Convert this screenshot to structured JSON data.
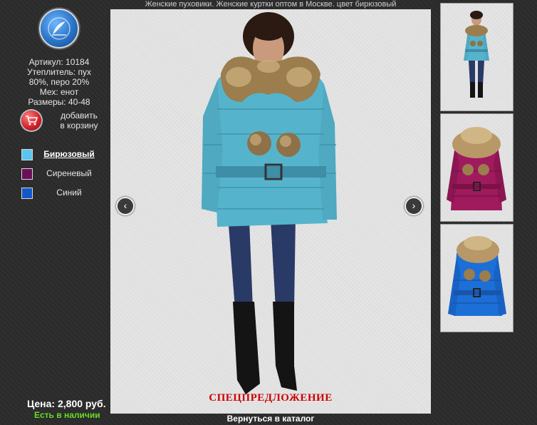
{
  "page_title": "Женские пуховики. Женские куртки оптом в Москве. цвет бирюзовый",
  "product": {
    "article": "Артикул: 10184",
    "insulation_line1": "Утеплитель: пух",
    "insulation_line2": "80%, перо 20%",
    "fur": "Мех: енот",
    "sizes": "Размеры: 40-48"
  },
  "cart": {
    "label_line1": "добавить",
    "label_line2": "в корзину",
    "icon": "shopping-cart-icon"
  },
  "colors": [
    {
      "name": "Бирюзовый",
      "hex": "#5bc4f0",
      "active": true
    },
    {
      "name": "Сиреневый",
      "hex": "#6b0f5a",
      "active": false
    },
    {
      "name": "Синий",
      "hex": "#1458c8",
      "active": false
    }
  ],
  "price": {
    "label": "Цена:",
    "value": "2,800 руб."
  },
  "stock": "Есть в наличии",
  "promo": "СПЕЦПРЕДЛОЖЕНИЕ",
  "back_link": "Вернуться в каталог",
  "gallery": {
    "prev_icon": "chevron-left-icon",
    "next_icon": "chevron-right-icon",
    "main_jacket_color": "#55b4cc",
    "thumbnails": [
      {
        "jacket_color": "#55b4cc"
      },
      {
        "jacket_color": "#a01a5e"
      },
      {
        "jacket_color": "#1d6fd8"
      }
    ]
  }
}
